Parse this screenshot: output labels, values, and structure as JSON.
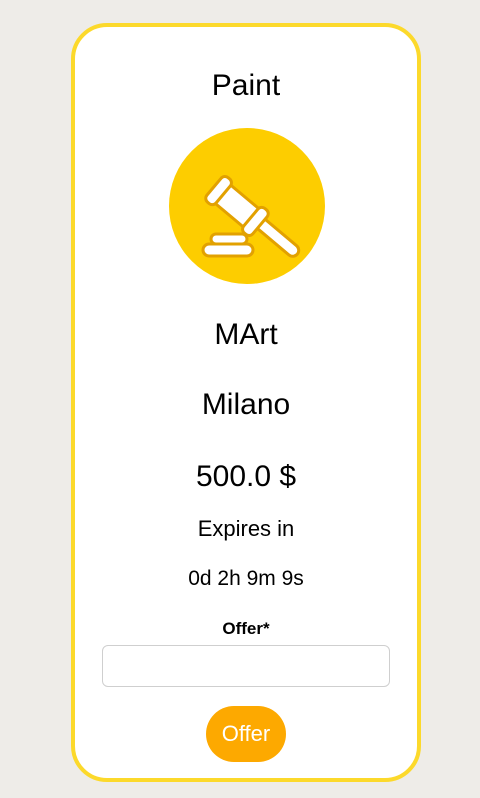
{
  "auction": {
    "title": "Paint",
    "icon": "gavel-icon",
    "seller": "MArt",
    "city": "Milano",
    "price": "500.0 $",
    "expires_label": "Expires in",
    "countdown": "0d 2h 9m 9s"
  },
  "offer_form": {
    "label": "Offer*",
    "input_value": "",
    "input_placeholder": "",
    "button_label": "Offer"
  },
  "colors": {
    "page_background": "#eeece8",
    "card_border": "#fcd92b",
    "icon_circle": "#fdcd00",
    "button_background": "#fda900",
    "button_text": "#ffffff"
  }
}
